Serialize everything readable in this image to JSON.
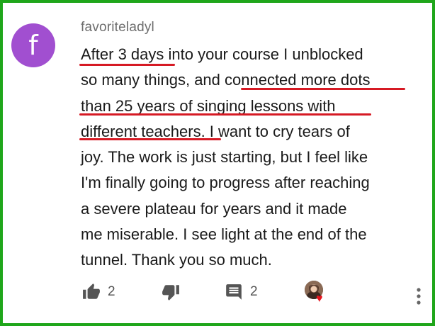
{
  "comment": {
    "avatar_letter": "f",
    "avatar_color": "#a14fd0",
    "username": "favoriteladyl",
    "lines": [
      "After 3 days into your course I unblocked",
      "so many things, and connected more dots",
      "than 25 years of singing lessons with",
      "different teachers. I want to cry tears of",
      "joy. The work is just starting, but I feel like",
      "I'm finally going to progress after reaching",
      "a severe plateau for years and it made",
      "me miserable. I see light at the end of the",
      "tunnel. Thank you so much."
    ],
    "highlighted_phrases": [
      "After 3 days",
      "connected more dots than 25 years of singing lessons with different teachers"
    ],
    "underline_color": "#d61a24"
  },
  "actions": {
    "like_icon": "thumbs-up-icon",
    "like_count": "2",
    "dislike_icon": "thumbs-down-icon",
    "reply_icon": "comment-icon",
    "reply_count": "2",
    "creator_heart_icon": "heart-icon",
    "menu_icon": "more-vert-icon"
  },
  "frame_color": "#1fa61a"
}
